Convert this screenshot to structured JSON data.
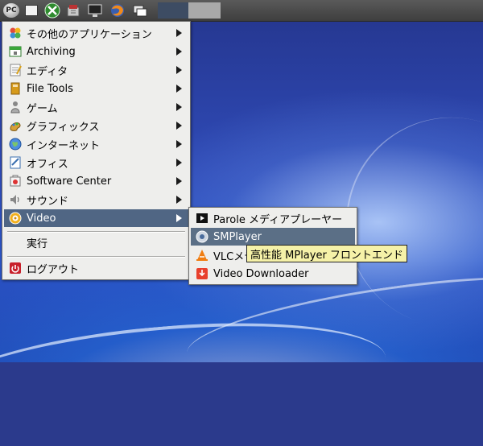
{
  "panel": {
    "launchers": [
      {
        "name": "pcmanfm-menu-icon",
        "text": "PC"
      },
      {
        "name": "folder-icon"
      },
      {
        "name": "xfce-icon"
      },
      {
        "name": "file-manager-icon"
      },
      {
        "name": "monitor-icon"
      },
      {
        "name": "firefox-icon"
      },
      {
        "name": "desktop-switch-icon"
      }
    ]
  },
  "main_menu": {
    "items": [
      {
        "label": "その他のアプリケーション",
        "icon": "other-apps-icon",
        "submenu": true
      },
      {
        "label": "Archiving",
        "icon": "archive-icon",
        "submenu": true
      },
      {
        "label": "エディタ",
        "icon": "editor-icon",
        "submenu": true
      },
      {
        "label": "File Tools",
        "icon": "file-tools-icon",
        "submenu": true
      },
      {
        "label": "ゲーム",
        "icon": "game-icon",
        "submenu": true
      },
      {
        "label": "グラフィックス",
        "icon": "graphics-icon",
        "submenu": true
      },
      {
        "label": "インターネット",
        "icon": "internet-icon",
        "submenu": true
      },
      {
        "label": "オフィス",
        "icon": "office-icon",
        "submenu": true
      },
      {
        "label": "Software Center",
        "icon": "software-center-icon",
        "submenu": true
      },
      {
        "label": "サウンド",
        "icon": "sound-icon",
        "submenu": true
      },
      {
        "label": "Video",
        "icon": "video-icon",
        "submenu": true,
        "selected": true
      }
    ],
    "run_label": "実行",
    "logout_label": "ログアウト"
  },
  "video_submenu": {
    "items": [
      {
        "label": "Parole メディアプレーヤー",
        "icon": "parole-icon"
      },
      {
        "label": "SMPlayer",
        "icon": "smplayer-icon",
        "hover": true
      },
      {
        "label": "VLCメデ",
        "icon": "vlc-icon"
      },
      {
        "label": "Video Downloader",
        "icon": "video-downloader-icon"
      }
    ]
  },
  "tooltip": {
    "text": "高性能 MPlayer フロントエンド"
  },
  "colors": {
    "selected": "#506684",
    "hover": "#5b6f86",
    "menu_bg": "#eeeeec",
    "tooltip_bg": "#f5f1a8"
  }
}
